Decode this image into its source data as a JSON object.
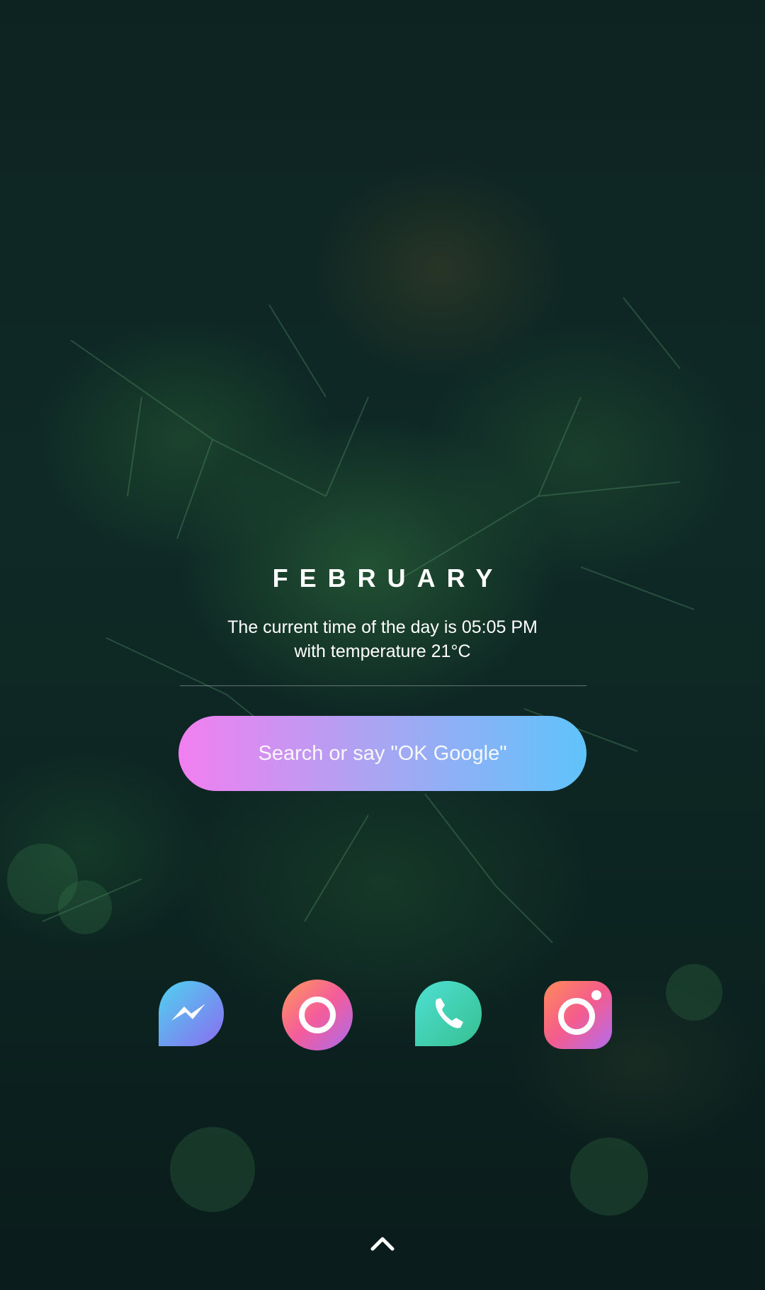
{
  "widget": {
    "month": "FEBRUARY",
    "time_line": "The current time of the day is 05:05 PM",
    "temp_line": "with temperature 21°C"
  },
  "search": {
    "placeholder": "Search or say \"OK Google\""
  },
  "dock": {
    "apps": [
      {
        "icon": "messenger-icon"
      },
      {
        "icon": "chrome-icon"
      },
      {
        "icon": "phone-icon"
      },
      {
        "icon": "camera-icon"
      }
    ]
  },
  "colors": {
    "search_gradient_start": "#f27ff0",
    "search_gradient_end": "#5fc3fb"
  }
}
